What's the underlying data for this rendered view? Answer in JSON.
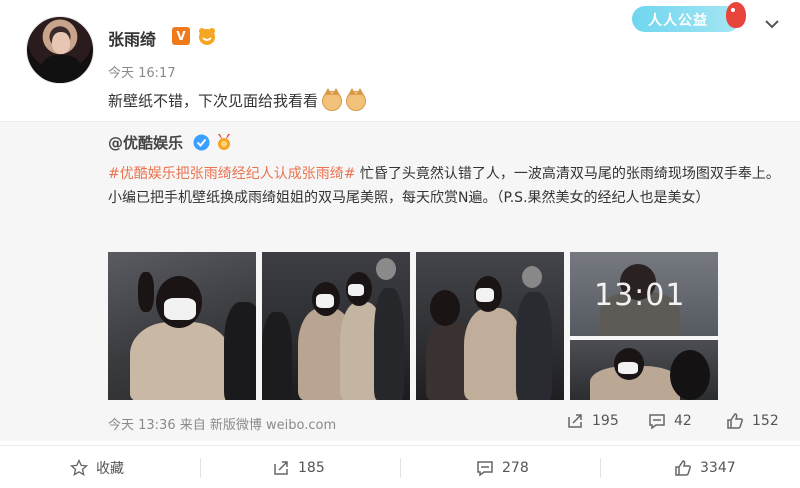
{
  "author": {
    "name": "张雨绮",
    "vip_badge": "V"
  },
  "post": {
    "time": "今天 16:17",
    "text": "新壁纸不错，下次见面给我看看",
    "emoji": [
      "cat-icon",
      "cat-icon"
    ]
  },
  "promo": {
    "label": "人人公益"
  },
  "repost": {
    "user": "@优酷娱乐",
    "hashtag": "#优酷娱乐把张雨绮经纪人认成张雨绮#",
    "body": " 忙昏了头竟然认错了人，一波高清双马尾的张雨绮现场图双手奉上。小编已把手机壁纸换成雨绮姐姐的双马尾美照，每天欣赏N遍。（P.S.果然美女的经纪人也是美女）",
    "photo_clock": "13:01",
    "meta": "今天 13:36 来自 新版微博 weibo.com",
    "stats": {
      "reposts": "195",
      "comments": "42",
      "likes": "152"
    }
  },
  "actions": {
    "favorite": "收藏",
    "reposts": "185",
    "comments": "278",
    "likes": "3347"
  },
  "colors": {
    "accent": "#eb7350",
    "verified": "#3aa0ff",
    "promo": "#6fd6ee"
  }
}
